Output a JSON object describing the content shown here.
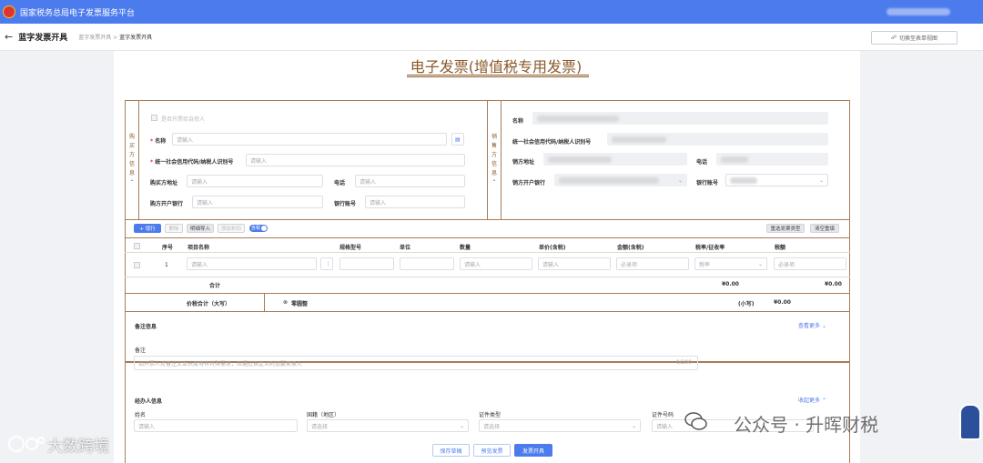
{
  "header": {
    "app_title": "国家税务总局电子发票服务平台"
  },
  "subheader": {
    "back_icon": "arrow-left-icon",
    "page_title": "蓝字发票开具",
    "breadcrumb": [
      "蓝字发票开具",
      ">",
      "蓝字发票开具"
    ],
    "switch_button": "切换至表单视图"
  },
  "invoice": {
    "title": "电子发票(增值税专用发票)",
    "buyer": {
      "side_label": "购买方信息",
      "natural_person_checkbox": "是否开票给自然人",
      "name_label": "名称",
      "name_placeholder": "请输入",
      "tax_id_label": "统一社会信用代码/纳税人识别号",
      "tax_id_placeholder": "请输入",
      "address_label": "购买方地址",
      "address_placeholder": "请输入",
      "phone_label": "电话",
      "phone_placeholder": "请输入",
      "bank_label": "购方开户银行",
      "bank_placeholder": "请输入",
      "account_label": "银行账号",
      "account_placeholder": "请输入"
    },
    "seller": {
      "side_label": "销售方信息",
      "name_label": "名称",
      "tax_id_label": "统一社会信用代码/纳税人识别号",
      "address_label": "销方地址",
      "phone_label": "电话",
      "bank_label": "销方开户银行",
      "account_label": "银行账号"
    },
    "toolbar": {
      "add_row": "+ 增行",
      "delete": "删除",
      "import": "明细导入",
      "add_discount": "添加折扣",
      "tax_toggle": "含税",
      "select_type": "重选发票类型",
      "clear": "清空重填"
    },
    "table": {
      "columns": [
        "序号",
        "项目名称",
        "规格型号",
        "单位",
        "数量",
        "单价(含税)",
        "金额(含税)",
        "税率/征收率",
        "税额"
      ],
      "rows": [
        {
          "index": "1",
          "item_placeholder": "请输入",
          "qty_placeholder": "请输入",
          "price_placeholder": "请输入",
          "amount_placeholder": "必录项",
          "rate_placeholder": "税率",
          "tax_placeholder": "必录项"
        }
      ],
      "total_label": "合计",
      "total_amount": "¥0.00",
      "total_tax": "¥0.00",
      "grand_total_label": "价税合计（大写）",
      "grand_total_words": "零圆整",
      "small_label": "(小写)",
      "grand_total_value": "¥0.00"
    },
    "remarks": {
      "section_title": "备注信息",
      "more": "查看更多",
      "label": "备注",
      "placeholder": "如开票人对备注文本长度等有特殊需求，应通过自定义附加要素录入",
      "counter": "0/200"
    },
    "agent": {
      "section_title": "经办人信息",
      "collapse": "收起更多",
      "name_label": "姓名",
      "name_placeholder": "请输入",
      "country_label": "国籍（地区）",
      "country_placeholder": "请选择",
      "id_type_label": "证件类型",
      "id_type_placeholder": "请选择",
      "id_number_label": "证件号码",
      "id_number_placeholder": "请输入"
    },
    "footer": {
      "save_draft": "保存草稿",
      "preview": "预览发票",
      "issue": "发票开具"
    }
  },
  "watermarks": {
    "left": "大数跨境",
    "right": "公众号 · 升晖财税"
  },
  "colors": {
    "primary": "#4b7bec",
    "invoice_brown": "#8b5a2b",
    "frame_brown": "#a77b58"
  }
}
